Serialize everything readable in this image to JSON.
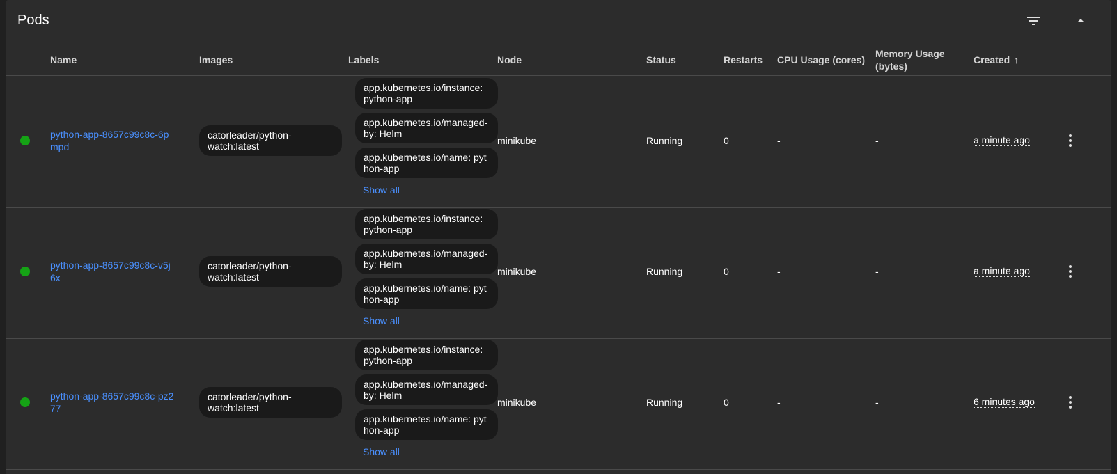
{
  "header": {
    "title": "Pods"
  },
  "columns": {
    "name": "Name",
    "images": "Images",
    "labels": "Labels",
    "node": "Node",
    "status": "Status",
    "restarts": "Restarts",
    "cpu": "CPU Usage (cores)",
    "memory_line1": "Memory Usage",
    "memory_line2": "(bytes)",
    "created": "Created"
  },
  "show_all_label": "Show all",
  "status_color": "#15a315",
  "link_color": "#4a90ff",
  "pods": [
    {
      "name": "python-app-8657c99c8c-6pmpd",
      "image": "catorleader/python-watch:latest",
      "labels": [
        "app.kubernetes.io/instance: python-app",
        "app.kubernetes.io/managed-by: Helm",
        "app.kubernetes.io/name: python-app"
      ],
      "node": "minikube",
      "status": "Running",
      "restarts": "0",
      "cpu": "-",
      "memory": "-",
      "created": "a minute ago"
    },
    {
      "name": "python-app-8657c99c8c-v5j6x",
      "image": "catorleader/python-watch:latest",
      "labels": [
        "app.kubernetes.io/instance: python-app",
        "app.kubernetes.io/managed-by: Helm",
        "app.kubernetes.io/name: python-app"
      ],
      "node": "minikube",
      "status": "Running",
      "restarts": "0",
      "cpu": "-",
      "memory": "-",
      "created": "a minute ago"
    },
    {
      "name": "python-app-8657c99c8c-pz277",
      "image": "catorleader/python-watch:latest",
      "labels": [
        "app.kubernetes.io/instance: python-app",
        "app.kubernetes.io/managed-by: Helm",
        "app.kubernetes.io/name: python-app"
      ],
      "node": "minikube",
      "status": "Running",
      "restarts": "0",
      "cpu": "-",
      "memory": "-",
      "created": "6 minutes ago"
    }
  ]
}
